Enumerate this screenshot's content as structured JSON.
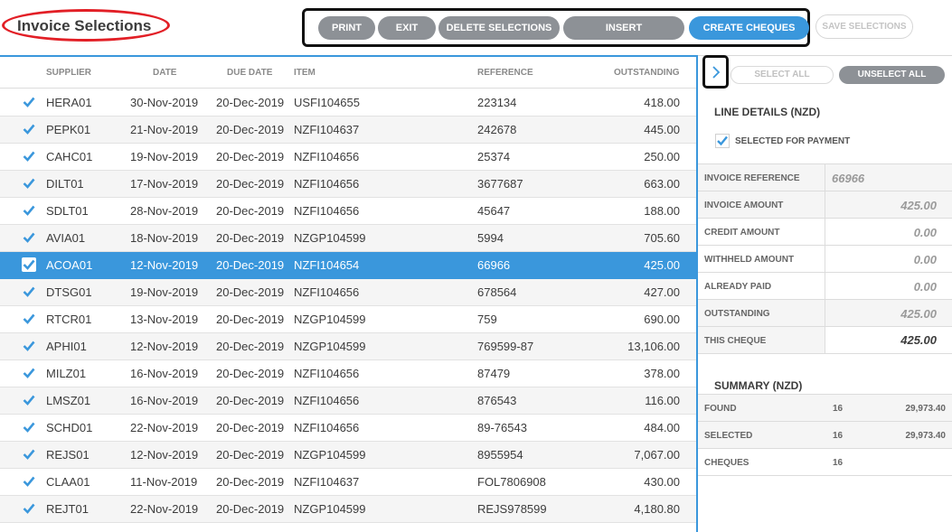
{
  "header": {
    "title": "Invoice Selections",
    "buttons": {
      "print": "PRINT",
      "exit": "EXIT",
      "delete": "DELETE SELECTIONS",
      "insert": "INSERT",
      "create": "CREATE CHEQUES",
      "save": "SAVE SELECTIONS"
    },
    "accent_color": "#3a97dc",
    "highlight_color": "#e21f26"
  },
  "table": {
    "columns": {
      "supplier": "SUPPLIER",
      "date": "DATE",
      "due_date": "DUE DATE",
      "item": "ITEM",
      "reference": "REFERENCE",
      "outstanding": "OUTSTANDING"
    },
    "rows": [
      {
        "supplier": "HERA01",
        "date": "30-Nov-2019",
        "due": "20-Dec-2019",
        "item": "USFI104655",
        "ref": "223134",
        "amount": "418.00",
        "checked": true
      },
      {
        "supplier": "PEPK01",
        "date": "21-Nov-2019",
        "due": "20-Dec-2019",
        "item": "NZFI104637",
        "ref": "242678",
        "amount": "445.00",
        "checked": true
      },
      {
        "supplier": "CAHC01",
        "date": "19-Nov-2019",
        "due": "20-Dec-2019",
        "item": "NZFI104656",
        "ref": "25374",
        "amount": "250.00",
        "checked": true
      },
      {
        "supplier": "DILT01",
        "date": "17-Nov-2019",
        "due": "20-Dec-2019",
        "item": "NZFI104656",
        "ref": "3677687",
        "amount": "663.00",
        "checked": true
      },
      {
        "supplier": "SDLT01",
        "date": "28-Nov-2019",
        "due": "20-Dec-2019",
        "item": "NZFI104656",
        "ref": "45647",
        "amount": "188.00",
        "checked": true
      },
      {
        "supplier": "AVIA01",
        "date": "18-Nov-2019",
        "due": "20-Dec-2019",
        "item": "NZGP104599",
        "ref": "5994",
        "amount": "705.60",
        "checked": true
      },
      {
        "supplier": "ACOA01",
        "date": "12-Nov-2019",
        "due": "20-Dec-2019",
        "item": "NZFI104654",
        "ref": "66966",
        "amount": "425.00",
        "checked": true,
        "selected": true
      },
      {
        "supplier": "DTSG01",
        "date": "19-Nov-2019",
        "due": "20-Dec-2019",
        "item": "NZFI104656",
        "ref": "678564",
        "amount": "427.00",
        "checked": true
      },
      {
        "supplier": "RTCR01",
        "date": "13-Nov-2019",
        "due": "20-Dec-2019",
        "item": "NZGP104599",
        "ref": "759",
        "amount": "690.00",
        "checked": true
      },
      {
        "supplier": "APHI01",
        "date": "12-Nov-2019",
        "due": "20-Dec-2019",
        "item": "NZGP104599",
        "ref": "769599-87",
        "amount": "13,106.00",
        "checked": true
      },
      {
        "supplier": "MILZ01",
        "date": "16-Nov-2019",
        "due": "20-Dec-2019",
        "item": "NZFI104656",
        "ref": "87479",
        "amount": "378.00",
        "checked": true
      },
      {
        "supplier": "LMSZ01",
        "date": "16-Nov-2019",
        "due": "20-Dec-2019",
        "item": "NZFI104656",
        "ref": "876543",
        "amount": "116.00",
        "checked": true
      },
      {
        "supplier": "SCHD01",
        "date": "22-Nov-2019",
        "due": "20-Dec-2019",
        "item": "NZFI104656",
        "ref": "89-76543",
        "amount": "484.00",
        "checked": true
      },
      {
        "supplier": "REJS01",
        "date": "12-Nov-2019",
        "due": "20-Dec-2019",
        "item": "NZGP104599",
        "ref": "8955954",
        "amount": "7,067.00",
        "checked": true
      },
      {
        "supplier": "CLAA01",
        "date": "11-Nov-2019",
        "due": "20-Dec-2019",
        "item": "NZFI104637",
        "ref": "FOL7806908",
        "amount": "430.00",
        "checked": true
      },
      {
        "supplier": "REJT01",
        "date": "22-Nov-2019",
        "due": "20-Dec-2019",
        "item": "NZGP104599",
        "ref": "REJS978599",
        "amount": "4,180.80",
        "checked": true
      }
    ]
  },
  "panel": {
    "select_all": "SELECT ALL",
    "unselect_all": "UNSELECT ALL",
    "line_details_title": "LINE DETAILS (NZD)",
    "selected_for_payment": "SELECTED FOR PAYMENT",
    "line_details": [
      {
        "label": "INVOICE REFERENCE",
        "value": "66966"
      },
      {
        "label": "INVOICE AMOUNT",
        "value": "425.00"
      },
      {
        "label": "CREDIT AMOUNT",
        "value": "0.00"
      },
      {
        "label": "WITHHELD AMOUNT",
        "value": "0.00"
      },
      {
        "label": "ALREADY PAID",
        "value": "0.00"
      },
      {
        "label": "OUTSTANDING",
        "value": "425.00"
      },
      {
        "label": "THIS CHEQUE",
        "value": "425.00"
      }
    ],
    "summary_title": "SUMMARY (NZD)",
    "summary": [
      {
        "label": "FOUND",
        "count": "16",
        "total": "29,973.40"
      },
      {
        "label": "SELECTED",
        "count": "16",
        "total": "29,973.40"
      },
      {
        "label": "CHEQUES",
        "count": "16",
        "total": ""
      }
    ]
  }
}
